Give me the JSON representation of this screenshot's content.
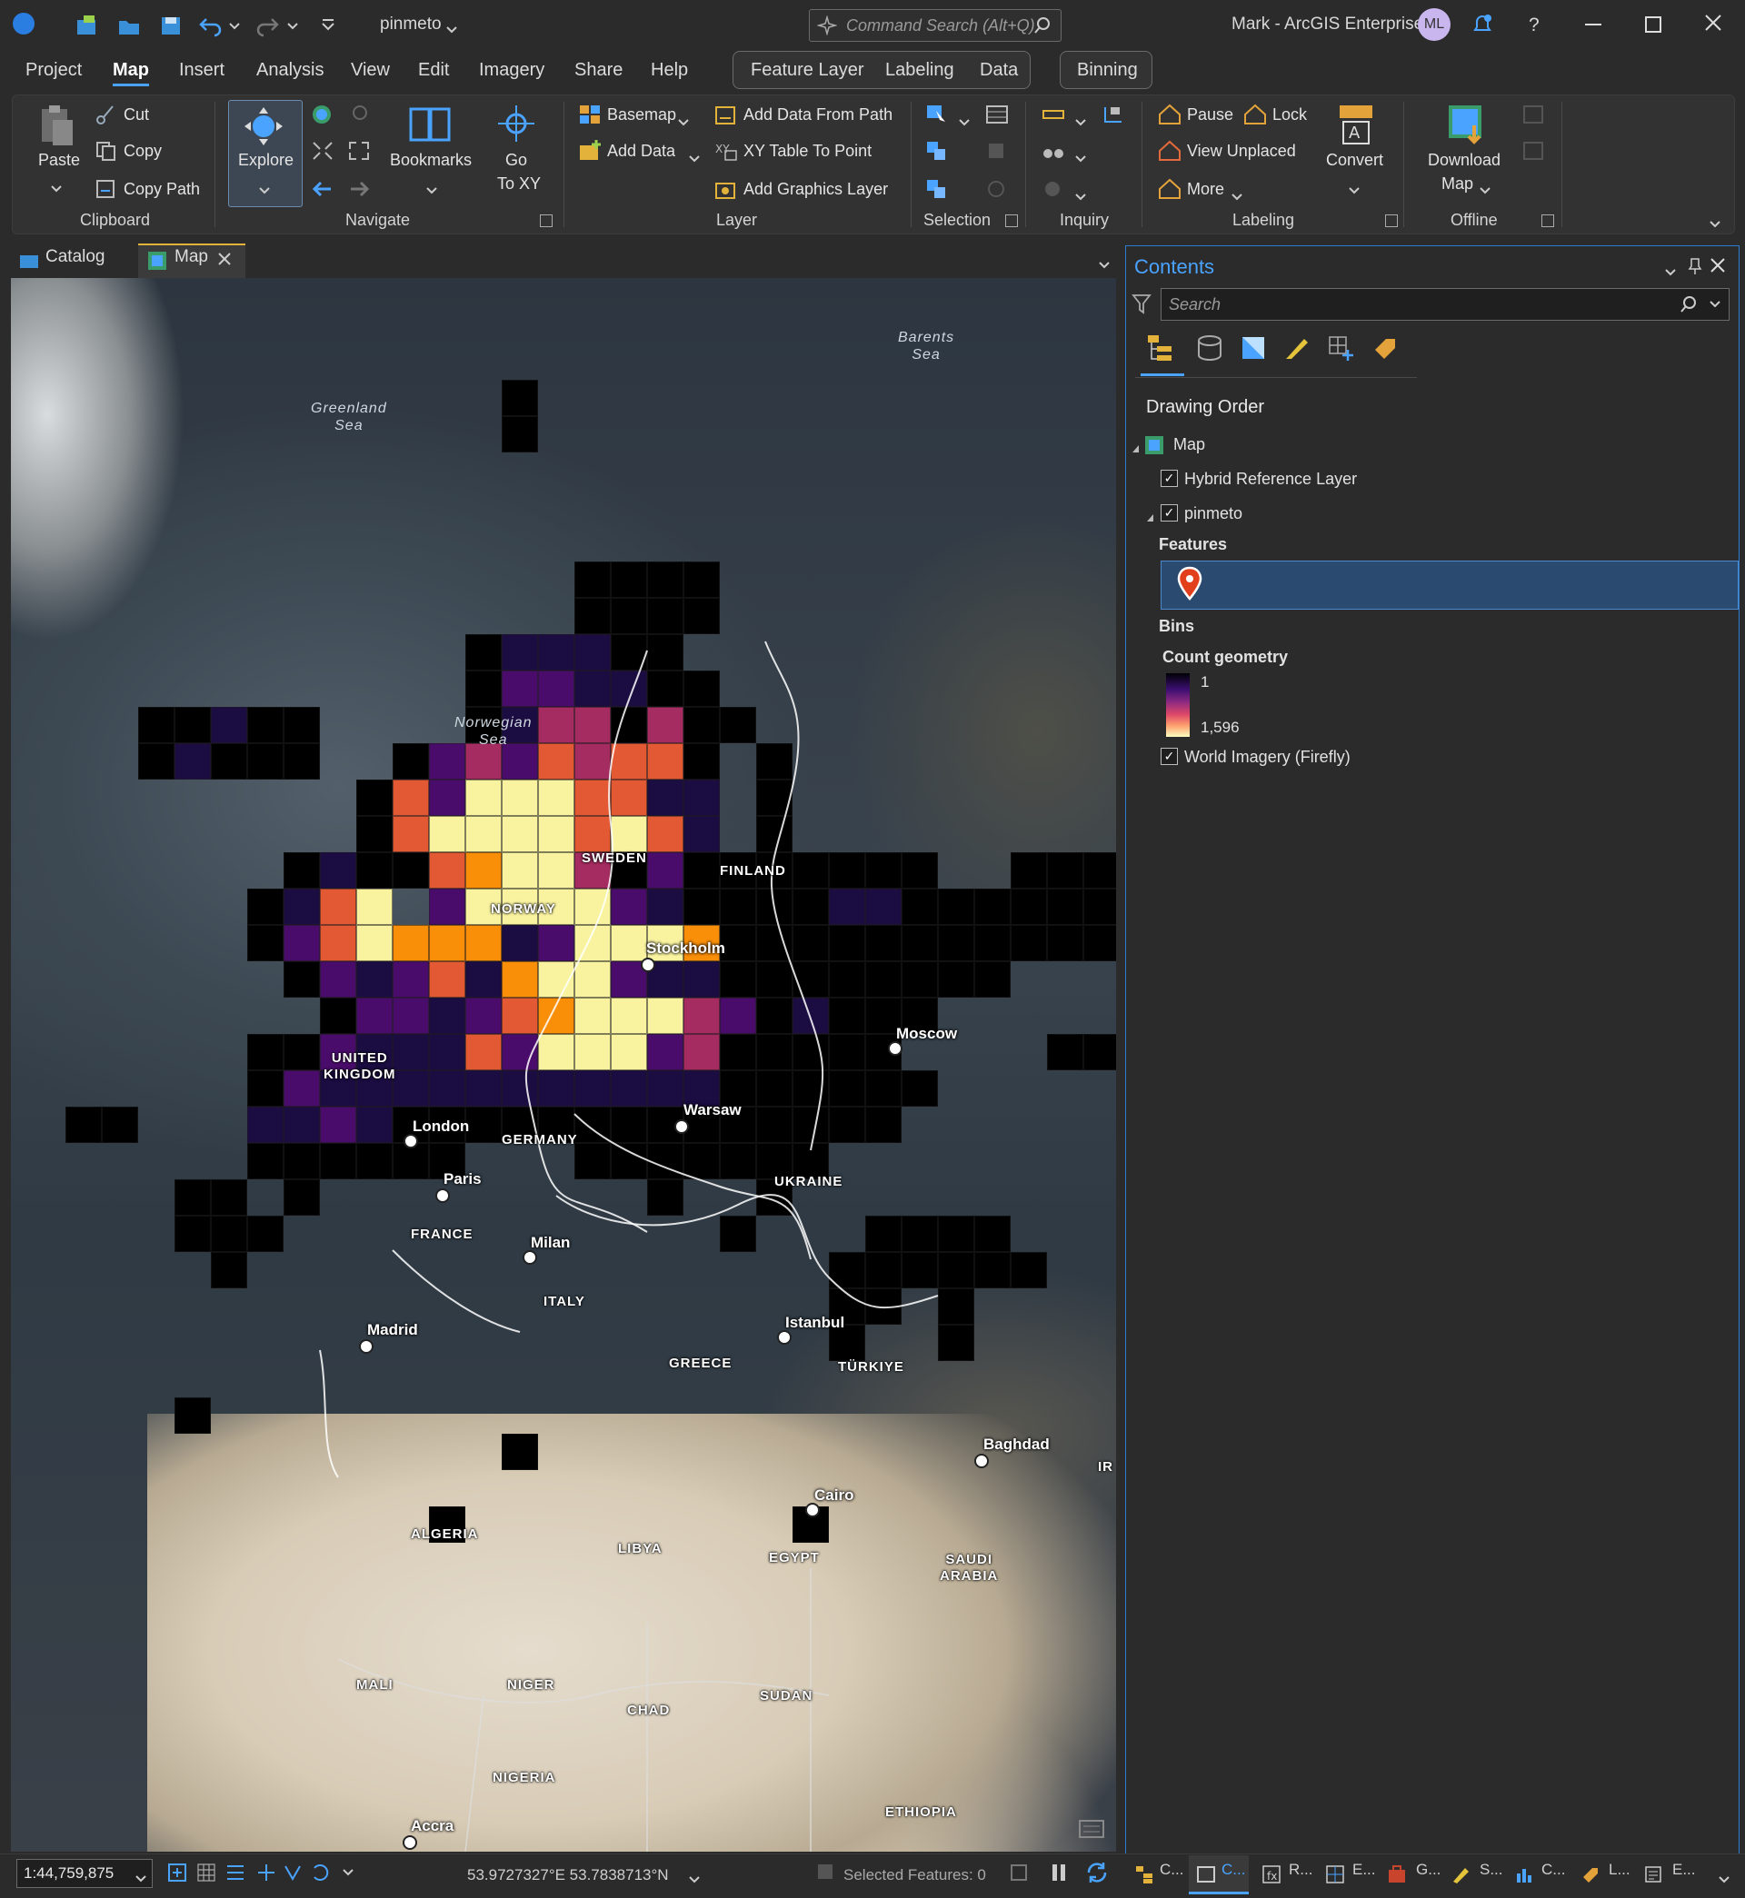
{
  "titlebar": {
    "project_name": "pinmeto",
    "command_search_placeholder": "Command Search (Alt+Q)",
    "user": "Mark - ArcGIS Enterprise",
    "avatar_initials": "ML",
    "help": "?"
  },
  "menu": {
    "tabs": [
      "Project",
      "Map",
      "Insert",
      "Analysis",
      "View",
      "Edit",
      "Imagery",
      "Share",
      "Help"
    ],
    "active_tab": "Map",
    "context_tabs": [
      "Feature Layer",
      "Labeling",
      "Data"
    ],
    "binning_tab": "Binning"
  },
  "ribbon": {
    "clipboard": {
      "paste": "Paste",
      "cut": "Cut",
      "copy": "Copy",
      "copy_path": "Copy Path",
      "group": "Clipboard"
    },
    "navigate": {
      "explore": "Explore",
      "bookmarks": "Bookmarks",
      "go": "Go",
      "to_xy": "To XY",
      "group": "Navigate"
    },
    "layer": {
      "basemap": "Basemap",
      "add_data": "Add Data",
      "add_data_from_path": "Add Data From Path",
      "xy_table": "XY Table To Point",
      "add_graphics": "Add Graphics Layer",
      "group": "Layer"
    },
    "selection": {
      "group": "Selection"
    },
    "inquiry": {
      "group": "Inquiry"
    },
    "labeling": {
      "pause": "Pause",
      "lock": "Lock",
      "view_unplaced": "View Unplaced",
      "more": "More",
      "convert": "Convert",
      "group": "Labeling"
    },
    "offline": {
      "download": "Download",
      "map": "Map",
      "group": "Offline"
    }
  },
  "doc_tabs": {
    "catalog": "Catalog",
    "map": "Map"
  },
  "map": {
    "seas": [
      {
        "name": "Greenland\nSea"
      },
      {
        "name": "Norwegian\nSea"
      },
      {
        "name": "Barents\nSea"
      }
    ],
    "countries": [
      "SWEDEN",
      "FINLAND",
      "NORWAY",
      "UNITED\nKINGDOM",
      "GERMANY",
      "UKRAINE",
      "FRANCE",
      "ITALY",
      "GREECE",
      "TÜRKIYE",
      "ALGERIA",
      "LIBYA",
      "EGYPT",
      "SAUDI\nARABIA",
      "MALI",
      "NIGER",
      "CHAD",
      "SUDAN",
      "NIGERIA",
      "ETHIOPIA",
      "IR"
    ],
    "cities": [
      "Stockholm",
      "Moscow",
      "London",
      "Warsaw",
      "Paris",
      "Milan",
      "Madrid",
      "Istanbul",
      "Baghdad",
      "Cairo",
      "Accra"
    ],
    "bin_colors": {
      "empty": "#000000",
      "low": "#1b0c41",
      "mid_low": "#4a0c6b",
      "mid": "#a52c60",
      "mid_high": "#e35933",
      "high": "#f98e09",
      "max": "#f9f3a0"
    }
  },
  "contents": {
    "title": "Contents",
    "search_placeholder": "Search",
    "drawing_order": "Drawing Order",
    "layers": {
      "map": "Map",
      "hybrid": "Hybrid Reference Layer",
      "pinmeto": "pinmeto",
      "features": "Features",
      "bins": "Bins",
      "count_geometry": "Count geometry",
      "legend_min": "1",
      "legend_max": "1,596",
      "world_imagery": "World Imagery (Firefly)"
    }
  },
  "status": {
    "scale": "1:44,759,875",
    "coordinates": "53.9727327°E 53.7838713°N",
    "selected": "Selected Features: 0"
  },
  "bottom_tabs": [
    "C...",
    "C...",
    "R...",
    "E...",
    "G...",
    "S...",
    "C...",
    "L...",
    "E..."
  ]
}
